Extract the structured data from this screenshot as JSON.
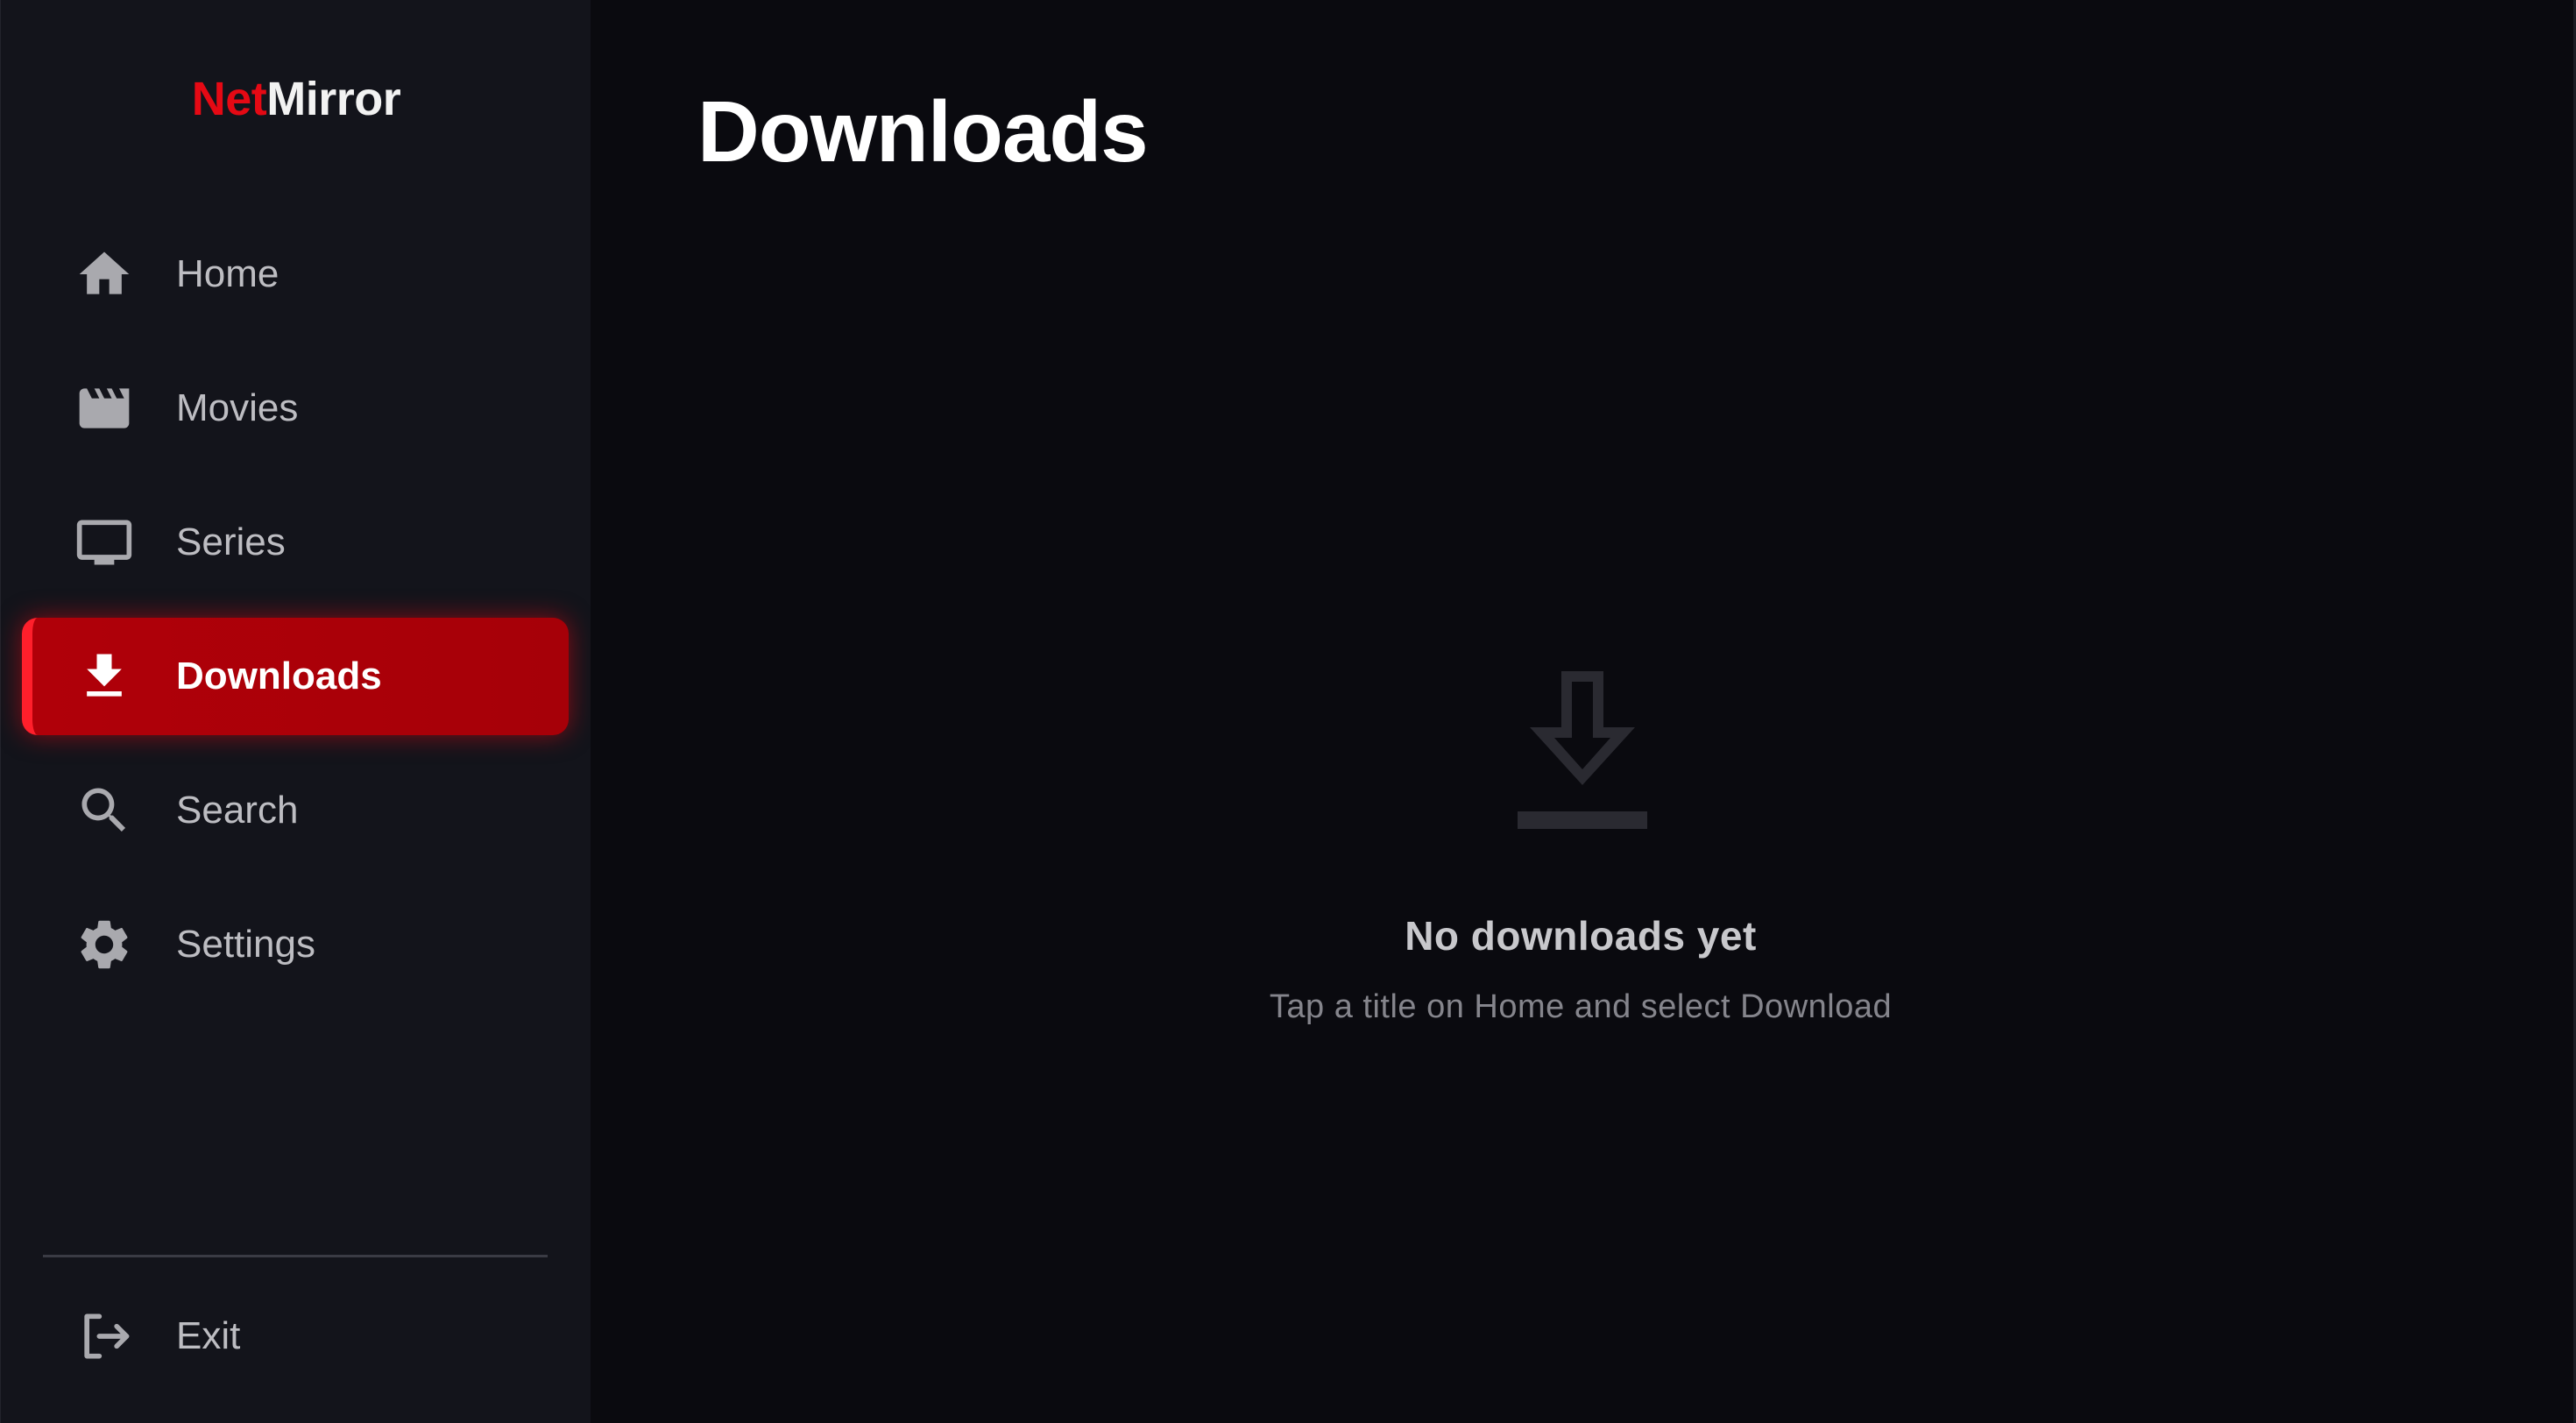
{
  "brand": {
    "part1": "Net",
    "part2": "Mirror",
    "accent_color": "#e50914"
  },
  "sidebar": {
    "items": [
      {
        "label": "Home",
        "icon": "home-icon",
        "active": false
      },
      {
        "label": "Movies",
        "icon": "movie-clapper-icon",
        "active": false
      },
      {
        "label": "Series",
        "icon": "tv-icon",
        "active": false
      },
      {
        "label": "Downloads",
        "icon": "download-icon",
        "active": true
      },
      {
        "label": "Search",
        "icon": "search-icon",
        "active": false
      },
      {
        "label": "Settings",
        "icon": "gear-icon",
        "active": false
      }
    ],
    "exit": {
      "label": "Exit",
      "icon": "logout-icon"
    }
  },
  "main": {
    "title": "Downloads",
    "empty_state": {
      "icon": "download-icon",
      "title": "No downloads yet",
      "subtitle": "Tap a title on Home and select Download"
    }
  },
  "colors": {
    "background": "#0a0a0f",
    "sidebar": "#13141b",
    "active_item": "#a80008",
    "text_muted": "#bdbdc2"
  }
}
